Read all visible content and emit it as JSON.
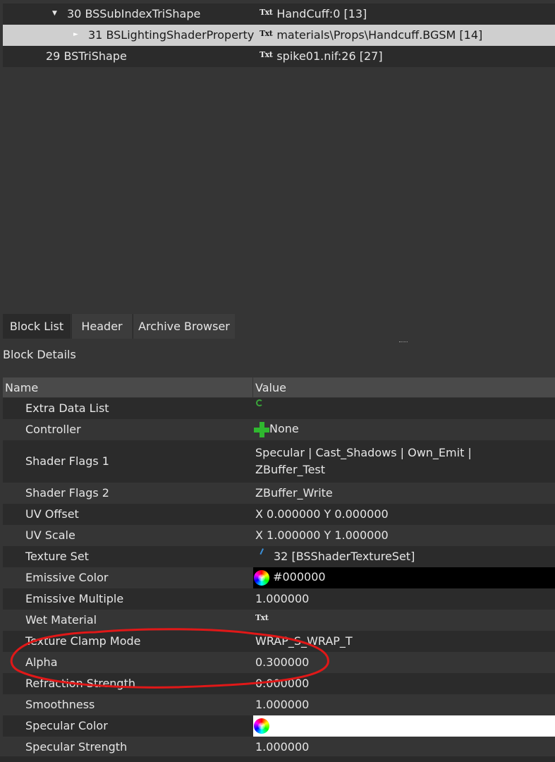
{
  "tree": {
    "rows": [
      {
        "id": "30",
        "name": "30 BSSubIndexTriShape",
        "value": "HandCuff:0 [13]",
        "txt": "Txt"
      },
      {
        "id": "31",
        "name": "31 BSLightingShaderProperty",
        "value": "materials\\Props\\Handcuff.BGSM [14]",
        "txt": "Txt"
      },
      {
        "id": "29",
        "name": "29 BSTriShape",
        "value": "spike01.nif:26 [27]",
        "txt": "Txt"
      }
    ]
  },
  "tabs": {
    "block_list": "Block List",
    "header": "Header",
    "archive_browser": "Archive Browser"
  },
  "details": {
    "title": "Block Details",
    "col_name": "Name",
    "col_value": "Value",
    "rows": [
      {
        "name": "Extra Data List",
        "value": ""
      },
      {
        "name": "Controller",
        "value": "None"
      },
      {
        "name": "Shader Flags 1",
        "value_line1": "Specular | Cast_Shadows | Own_Emit |",
        "value_line2": "ZBuffer_Test"
      },
      {
        "name": "Shader Flags 2",
        "value": "ZBuffer_Write"
      },
      {
        "name": "UV Offset",
        "value": "X 0.000000 Y 0.000000"
      },
      {
        "name": "UV Scale",
        "value": "X 1.000000 Y 1.000000"
      },
      {
        "name": "Texture Set",
        "value": "32 [BSShaderTextureSet]"
      },
      {
        "name": "Emissive Color",
        "value": "#000000",
        "color": "#000000"
      },
      {
        "name": "Emissive Multiple",
        "value": "1.000000"
      },
      {
        "name": "Wet Material",
        "value": "Txt"
      },
      {
        "name": "Texture Clamp Mode",
        "value": "WRAP_S_WRAP_T"
      },
      {
        "name": "Alpha",
        "value": "0.300000"
      },
      {
        "name": "Refraction Strength",
        "value": "0.000000"
      },
      {
        "name": "Smoothness",
        "value": "1.000000"
      },
      {
        "name": "Specular Color",
        "value": "",
        "color": "#ffffff"
      },
      {
        "name": "Specular Strength",
        "value": "1.000000"
      }
    ]
  },
  "colors": {
    "background": "#353535",
    "row_alt": "#2b2b2b",
    "selection": "#cfcfcf",
    "header": "#4a4a4a",
    "annotation": "#e01818"
  }
}
